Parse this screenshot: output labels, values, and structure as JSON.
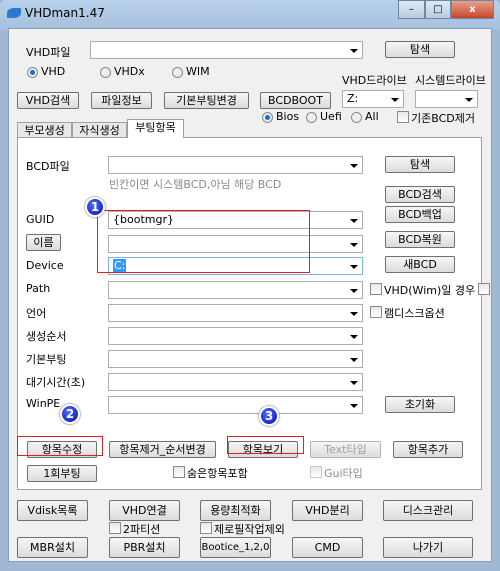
{
  "window": {
    "title": "VHDman1.47",
    "minimize": "–",
    "maximize": "□",
    "close": "x"
  },
  "top": {
    "vhd_file_label": "VHD파일",
    "vhd_file_value": "",
    "browse": "탐색",
    "radios": [
      {
        "label": "VHD",
        "checked": true
      },
      {
        "label": "VHDx",
        "checked": false
      },
      {
        "label": "WIM",
        "checked": false
      }
    ],
    "vhd_drive_label": "VHD드라이브",
    "system_drive_label": "시스템드라이브",
    "vhd_drive_value": "Z:",
    "system_drive_value": "",
    "buttons": [
      "VHD검색",
      "파일정보",
      "기본부팅변경",
      "BCDBOOT"
    ],
    "boot_radios": [
      {
        "label": "Bios",
        "checked": true
      },
      {
        "label": "Uefi",
        "checked": false
      },
      {
        "label": "All",
        "checked": false
      }
    ],
    "remove_bcd_label": "기존BCD제거"
  },
  "tabs": [
    {
      "label": "부모생성"
    },
    {
      "label": "자식생성"
    },
    {
      "label": "부팅항목",
      "active": true
    }
  ],
  "panel": {
    "bcd_file_label": "BCD파일",
    "bcd_hint": "빈칸이면 시스템BCD,아님 해당 BCD",
    "fields": [
      {
        "label": "GUID",
        "value": "{bootmgr}"
      },
      {
        "label": "이름",
        "value": ""
      },
      {
        "label": "Device",
        "value": "C:"
      },
      {
        "label": "Path",
        "value": ""
      },
      {
        "label": "언어",
        "value": ""
      },
      {
        "label": "생성순서",
        "value": ""
      },
      {
        "label": "기본부팅",
        "value": ""
      },
      {
        "label": "대기시간(초)",
        "value": ""
      },
      {
        "label": "WinPE",
        "value": ""
      }
    ],
    "right_buttons": [
      "탐색",
      "BCD검색",
      "BCD백업",
      "BCD복원",
      "새BCD"
    ],
    "vhd_wim_label": "VHD(Wim)일 경우",
    "ramdisk_label": "램디스크옵션",
    "reset": "초기화",
    "action_buttons": [
      "항목수정",
      "항목제거_순서변경",
      "항목보기",
      "Text타입",
      "항목추가"
    ],
    "one_time_boot": "1회부팅",
    "include_hidden": "숨은항목포함",
    "gui_type": "Gui타입",
    "markers": [
      "1",
      "2",
      "3"
    ]
  },
  "bottom": {
    "row1": [
      "Vdisk목록",
      "VHD연결",
      "용량최적화",
      "VHD분리",
      "디스크관리"
    ],
    "two_partition": "2파티션",
    "exclude_zerofill": "제로필작업제외",
    "row2": [
      "MBR설치",
      "PBR설치",
      "Bootice_1,2,0",
      "CMD",
      "나가기"
    ]
  }
}
